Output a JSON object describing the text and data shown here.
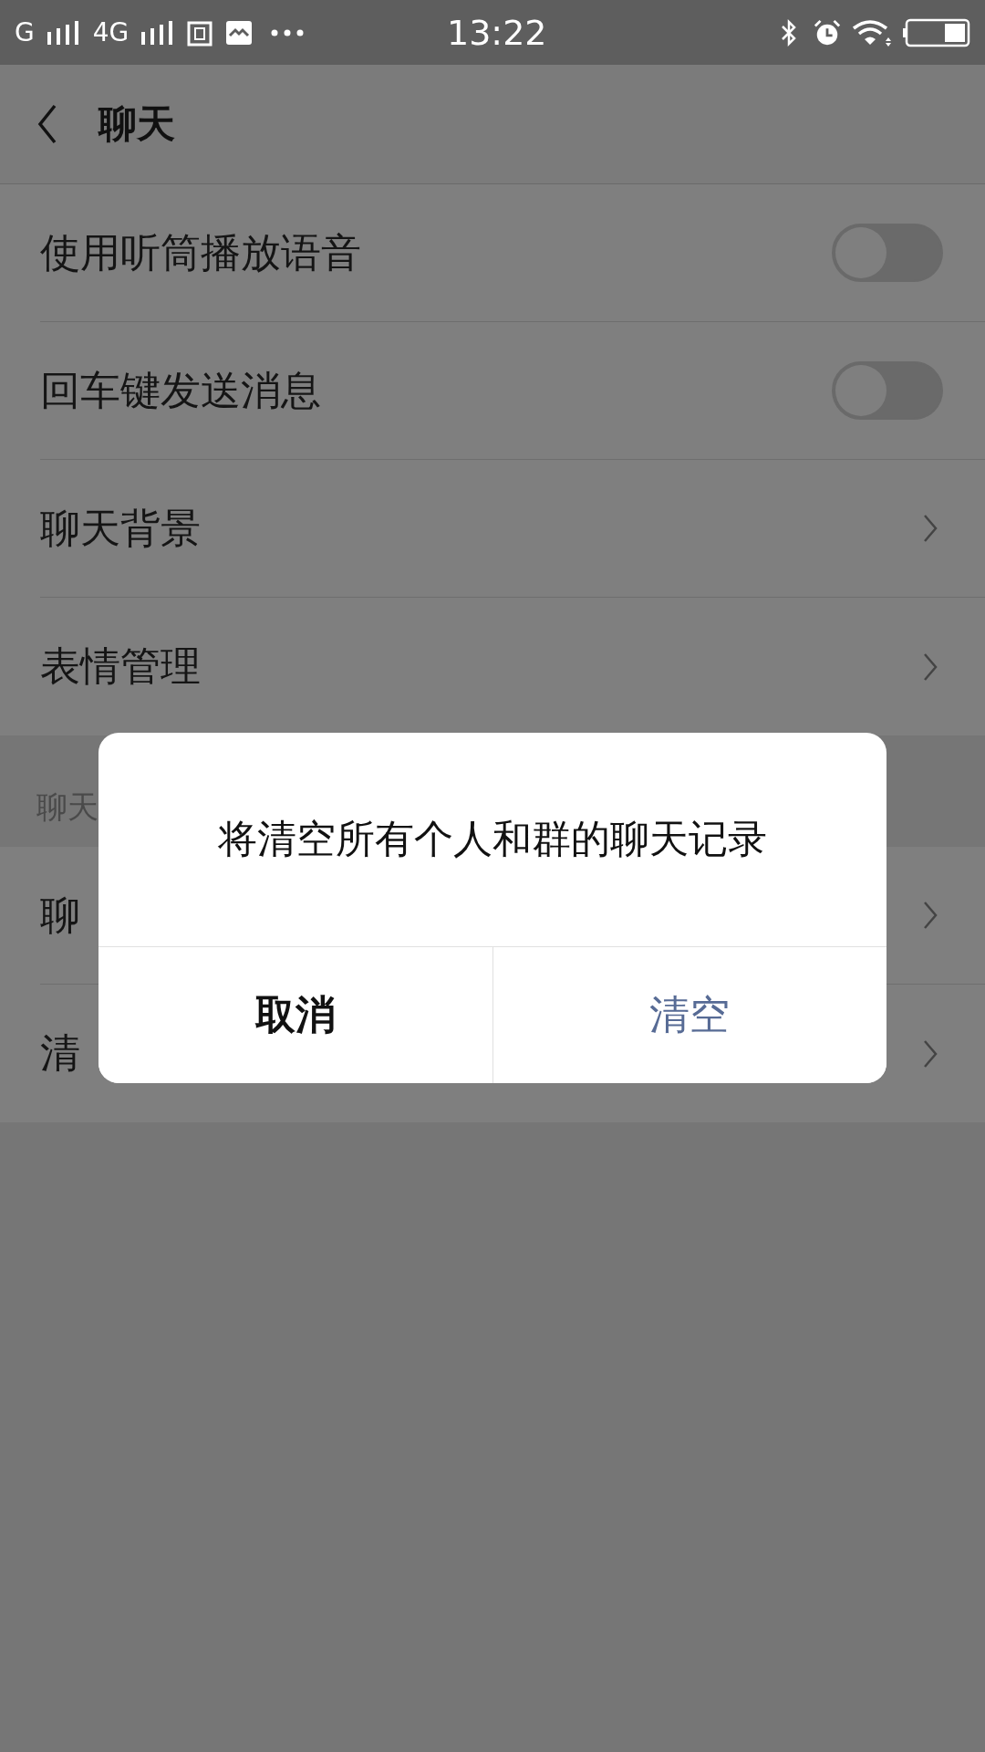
{
  "status_bar": {
    "carrier_1": "G",
    "carrier_2": "4G",
    "time": "13:22"
  },
  "header": {
    "title": "聊天"
  },
  "settings": [
    {
      "kind": "toggle",
      "label": "使用听筒播放语音",
      "on": false
    },
    {
      "kind": "toggle",
      "label": "回车键发送消息",
      "on": false
    },
    {
      "kind": "link",
      "label": "聊天背景"
    },
    {
      "kind": "link",
      "label": "表情管理"
    }
  ],
  "section": {
    "title": "聊天",
    "items": [
      {
        "label": "聊"
      },
      {
        "label": "清"
      }
    ]
  },
  "dialog": {
    "message": "将清空所有个人和群的聊天记录",
    "buttons": [
      {
        "kind": "cancel",
        "label": "取消"
      },
      {
        "kind": "confirm",
        "label": "清空"
      }
    ]
  }
}
